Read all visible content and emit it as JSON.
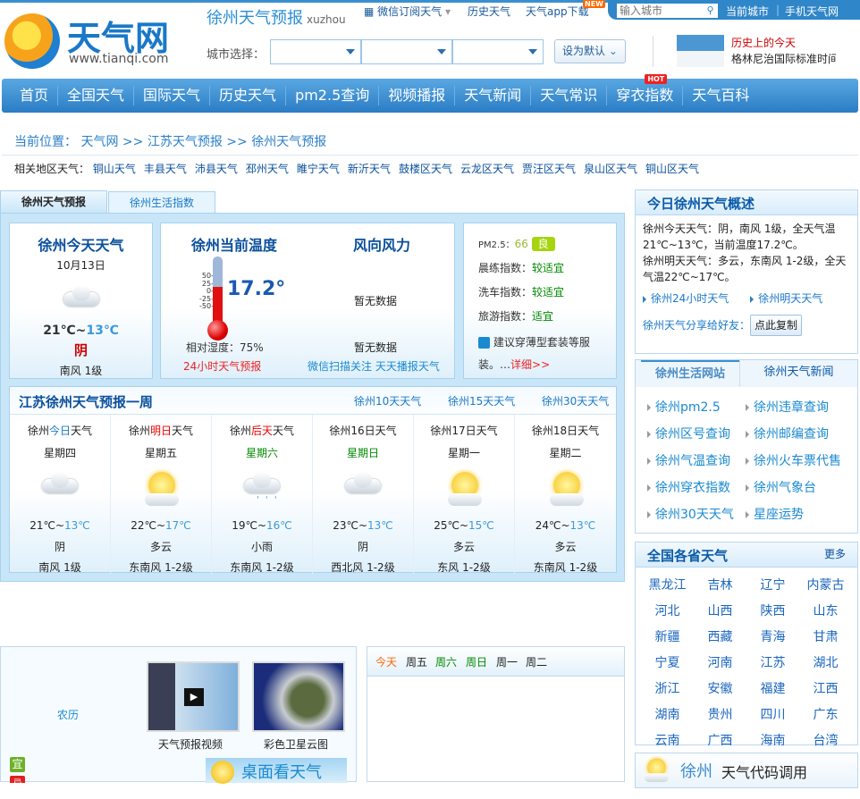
{
  "header": {
    "logo_text": "天气网",
    "logo_url": "www.tianqi.com",
    "city_title": "徐州天气预报",
    "city_pinyin": "xuzhou",
    "links": {
      "wechat": "微信订阅天气",
      "history": "历史天气",
      "app": "天气app下载",
      "app_badge": "NEW"
    },
    "search_placeholder": "输入城市",
    "current_city": "当前城市",
    "mobile": "手机天气网",
    "city_select_label": "城市选择：",
    "set_default": "设为默认",
    "history_today_title": "历史上的今天",
    "history_today_text": "格林尼治国际标准时间"
  },
  "nav": {
    "items": [
      "首页",
      "全国天气",
      "国际天气",
      "历史天气",
      "pm2.5查询",
      "视频播报",
      "天气新闻",
      "天气常识",
      "穿衣指数",
      "天气百科"
    ],
    "hot_badge": "HOT"
  },
  "breadcrumb": {
    "label": "当前位置：",
    "items": [
      "天气网",
      "江苏天气预报",
      "徐州天气预报"
    ],
    "sep": ">>"
  },
  "related": {
    "label": "相关地区天气：",
    "items": [
      "铜山天气",
      "丰县天气",
      "沛县天气",
      "邳州天气",
      "睢宁天气",
      "新沂天气",
      "鼓楼区天气",
      "云龙区天气",
      "贾汪区天气",
      "泉山区天气",
      "铜山区天气"
    ]
  },
  "tabs": [
    "徐州天气预报",
    "徐州生活指数"
  ],
  "today": {
    "title": "徐州今天天气",
    "date": "10月13日",
    "high": "21℃",
    "low": "13℃",
    "sep": "~",
    "weather": "阴",
    "wind": "南风 1级"
  },
  "current": {
    "title": "徐州当前温度",
    "temp": "17.2°",
    "temp_value": 17.2,
    "scale": [
      "50-",
      "25-",
      "0-",
      "-25-",
      "-50-"
    ],
    "humidity": "相对湿度：75%",
    "link24": "24小时天气预报",
    "wind_title": "风向风力",
    "wind_value": "暂无数据",
    "wind_value2": "暂无数据",
    "wechat_link": "微信扫描关注 天天播报天气"
  },
  "index": {
    "pm_label": "PM2.5：",
    "pm_value": "66",
    "pm_level": "良",
    "items": [
      {
        "label": "晨练指数：",
        "value": "较适宜"
      },
      {
        "label": "洗车指数：",
        "value": "较适宜"
      },
      {
        "label": "旅游指数：",
        "value": "适宜"
      }
    ],
    "dress": "建议穿薄型套装等服装。…",
    "detail": "详细>>"
  },
  "week": {
    "title": "江苏徐州天气预报一周",
    "links": [
      "徐州10天天气",
      "徐州15天天气",
      "徐州30天天气"
    ],
    "days": [
      {
        "pre": "徐州",
        "hl": "今日",
        "post": "天气",
        "hl_color": "#1a78c8",
        "weekday": "星期四",
        "wd_color": "#222",
        "icon": "cloudy",
        "high": "21℃",
        "low": "13℃",
        "weather": "阴",
        "wind": "南风 1级"
      },
      {
        "pre": "徐州",
        "hl": "明日",
        "post": "天气",
        "hl_color": "#e00",
        "weekday": "星期五",
        "wd_color": "#222",
        "icon": "partly-sunny",
        "high": "22℃",
        "low": "17℃",
        "weather": "多云",
        "wind": "东南风 1-2级"
      },
      {
        "pre": "徐州",
        "hl": "后天",
        "post": "天气",
        "hl_color": "#e00",
        "weekday": "星期六",
        "wd_color": "#080",
        "icon": "light-rain",
        "high": "19℃",
        "low": "16℃",
        "weather": "小雨",
        "wind": "东南风 1-2级"
      },
      {
        "pre": "徐州",
        "hl": "16日",
        "post": "天气",
        "hl_color": "#222",
        "weekday": "星期日",
        "wd_color": "#080",
        "icon": "cloudy",
        "high": "23℃",
        "low": "13℃",
        "weather": "阴",
        "wind": "西北风 1-2级"
      },
      {
        "pre": "徐州",
        "hl": "17日",
        "post": "天气",
        "hl_color": "#222",
        "weekday": "星期一",
        "wd_color": "#222",
        "icon": "partly-sunny",
        "high": "25℃",
        "low": "15℃",
        "weather": "多云",
        "wind": "东风 1-2级"
      },
      {
        "pre": "徐州",
        "hl": "18日",
        "post": "天气",
        "hl_color": "#222",
        "weekday": "星期二",
        "wd_color": "#222",
        "icon": "partly-sunny",
        "high": "24℃",
        "low": "13℃",
        "weather": "多云",
        "wind": "东南风 1-2级"
      }
    ]
  },
  "bottom": {
    "lunar": "农历",
    "yi": "宜",
    "ji": "忌",
    "video": "天气预报视频",
    "satellite": "彩色卫星云图",
    "desktop": "桌面看天气",
    "day_tabs": [
      "今天",
      "周五",
      "周六",
      "周日",
      "周一",
      "周二"
    ]
  },
  "summary": {
    "title": "今日徐州天气概述",
    "text1": "徐州今天天气：阴，南风 1级，全天气温21℃~13℃，当前温度17.2℃。",
    "text2": "徐州明天天气：多云，东南风 1-2级，全天气温22℃~17℃。",
    "link1": "徐州24小时天气",
    "link2": "徐州明天天气",
    "share": "徐州天气分享给好友：",
    "copy": "点此复制"
  },
  "life": {
    "tabs": [
      "徐州生活网站",
      "徐州天气新闻"
    ],
    "items": [
      "徐州pm2.5",
      "徐州违章查询",
      "徐州区号查询",
      "徐州邮编查询",
      "徐州气温查询",
      "徐州火车票代售",
      "徐州穿衣指数",
      "徐州气象台",
      "徐州30天天气",
      "星座运势"
    ]
  },
  "provinces": {
    "title": "全国各省天气",
    "more": "更多",
    "items": [
      "黑龙江",
      "吉林",
      "辽宁",
      "内蒙古",
      "河北",
      "山西",
      "陕西",
      "山东",
      "新疆",
      "西藏",
      "青海",
      "甘肃",
      "宁夏",
      "河南",
      "江苏",
      "湖北",
      "浙江",
      "安徽",
      "福建",
      "江西",
      "湖南",
      "贵州",
      "四川",
      "广东",
      "云南",
      "广西",
      "海南",
      "台湾"
    ]
  },
  "code": {
    "city": "徐州",
    "text": "天气代码调用"
  }
}
